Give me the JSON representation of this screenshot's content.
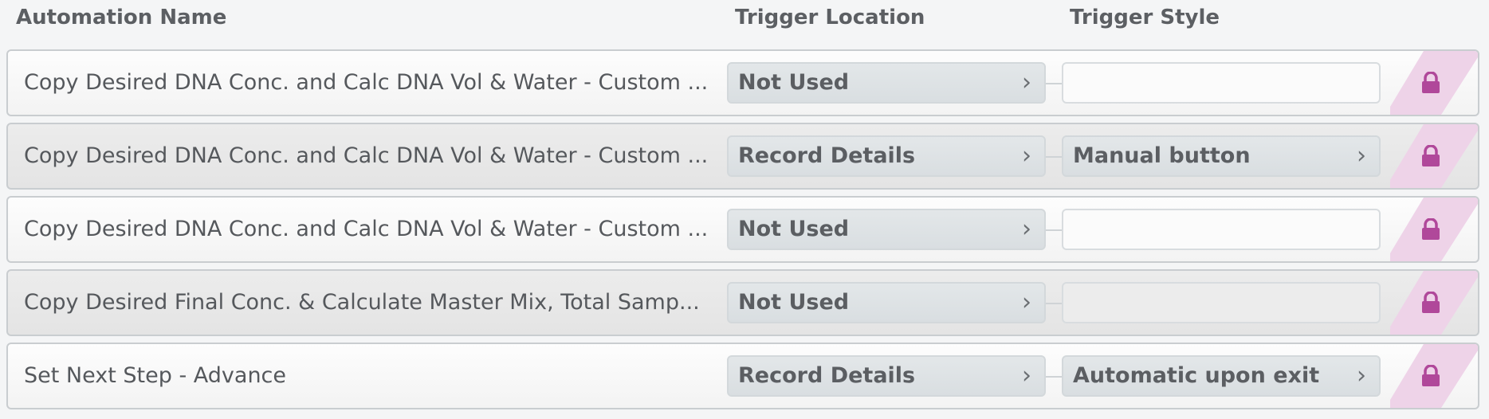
{
  "header": {
    "automation_name": "Automation Name",
    "trigger_location": "Trigger Location",
    "trigger_style": "Trigger Style"
  },
  "colors": {
    "lock": "#b0489a",
    "lock_stripe": "#eed3e8"
  },
  "rows": [
    {
      "name": "Copy Desired DNA Conc. and Calc DNA Vol & Water - Custom ...",
      "trigger_location": "Not Used",
      "trigger_style": "",
      "locked": true
    },
    {
      "name": "Copy Desired DNA Conc. and Calc DNA Vol & Water - Custom ...",
      "trigger_location": "Record Details",
      "trigger_style": "Manual button",
      "locked": true
    },
    {
      "name": "Copy Desired DNA Conc. and Calc DNA Vol & Water - Custom ...",
      "trigger_location": "Not Used",
      "trigger_style": "",
      "locked": true
    },
    {
      "name": "Copy Desired Final Conc. & Calculate Master Mix, Total Samp...",
      "trigger_location": "Not Used",
      "trigger_style": "",
      "locked": true
    },
    {
      "name": "Set Next Step - Advance",
      "trigger_location": "Record Details",
      "trigger_style": "Automatic upon exit",
      "locked": true
    }
  ]
}
